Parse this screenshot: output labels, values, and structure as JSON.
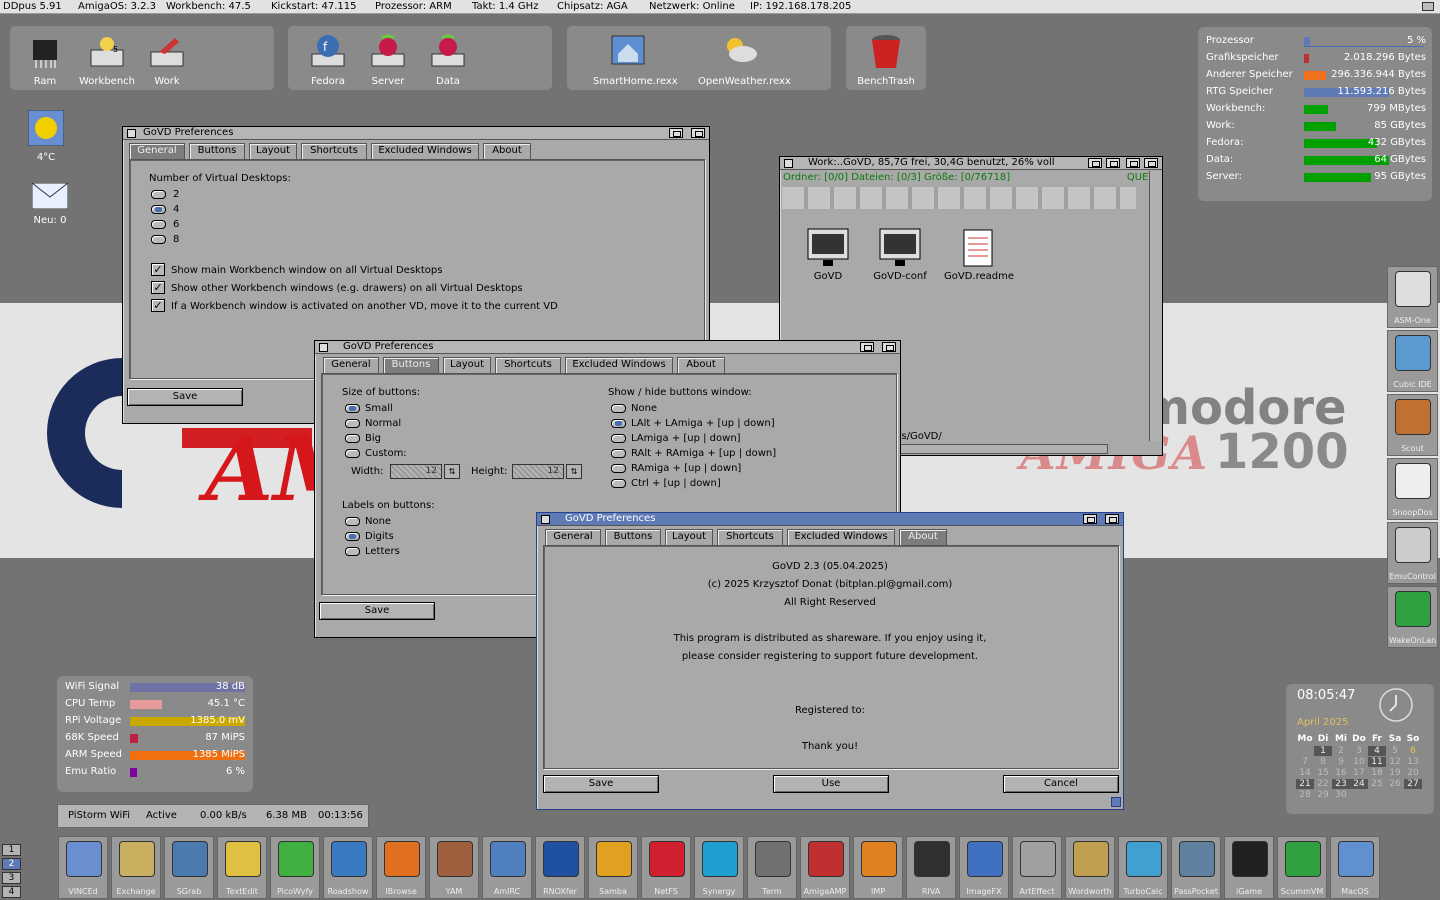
{
  "menubar": {
    "items": [
      "DDpus 5.91",
      "AmigaOS: 3.2.3",
      "Workbench: 47.5",
      "Kickstart: 47.115",
      "Prozessor: ARM",
      "Takt: 1.4 GHz",
      "Chipsatz: AGA",
      "Netzwerk: Online",
      "IP: 192.168.178.205"
    ]
  },
  "top_icons": {
    "panel1": [
      "Ram",
      "Workbench",
      "Work"
    ],
    "panel2": [
      "Fedora",
      "Server",
      "Data"
    ],
    "panel3": [
      "SmartHome.rexx",
      "OpenWeather.rexx"
    ],
    "panel4": [
      "BenchTrash"
    ]
  },
  "desktop_icons": {
    "weather": "4°C",
    "mail": "Neu: 0"
  },
  "backdrop": {
    "modore": "modore",
    "amiga_red": "AMIGA",
    "amiga_num": "1200",
    "am": "AM"
  },
  "win_general": {
    "title": "GoVD Preferences",
    "tabs": [
      "General",
      "Buttons",
      "Layout",
      "Shortcuts",
      "Excluded Windows",
      "About"
    ],
    "num_label": "Number of Virtual Desktops:",
    "num_options": [
      "2",
      "4",
      "6",
      "8"
    ],
    "checks": [
      "Show main Workbench window on all Virtual Desktops",
      "Show other Workbench windows (e.g. drawers) on all Virtual Desktops",
      "If a Workbench window is activated on another VD, move it to the current VD"
    ],
    "save": "Save"
  },
  "win_buttons": {
    "title": "GoVD Preferences",
    "tabs": [
      "General",
      "Buttons",
      "Layout",
      "Shortcuts",
      "Excluded Windows",
      "About"
    ],
    "size_label": "Size of buttons:",
    "size_options": [
      "Small",
      "Normal",
      "Big",
      "Custom:"
    ],
    "width_label": "Width:",
    "width_value": "12",
    "height_label": "Height:",
    "height_value": "12",
    "labels_label": "Labels on buttons:",
    "labels_options": [
      "None",
      "Digits",
      "Letters"
    ],
    "show_label": "Show / hide buttons window:",
    "show_options": [
      "None",
      "LAlt + LAmiga + [up | down]",
      "LAmiga + [up | down]",
      "RAlt + RAmiga + [up | down]",
      "RAmiga + [up | down]",
      "Ctrl + [up | down]"
    ],
    "save": "Save"
  },
  "win_about": {
    "title": "GoVD Preferences",
    "tabs": [
      "General",
      "Buttons",
      "Layout",
      "Shortcuts",
      "Excluded Windows",
      "About"
    ],
    "lines": [
      "GoVD 2.3  (05.04.2025)",
      "(c) 2025 Krzysztof Donat (bitplan.pl@gmail.com)",
      "All Right Reserved",
      "This program is distributed as shareware. If you enjoy using it,",
      "please consider registering to support future development.",
      "Registered to:",
      "Thank you!"
    ],
    "save": "Save",
    "use": "Use",
    "cancel": "Cancel"
  },
  "win_work": {
    "title": "Work:..GoVD,  85,7G frei, 30,4G benutzt, 26% voll",
    "status": "Ordner: [0/0] Dateien: [0/3] Größe: [0/76718]",
    "quel": "QUEL",
    "path": "/s/GoVD/",
    "files": [
      "GoVD",
      "GoVD-conf",
      "GoVD.readme"
    ]
  },
  "stats": {
    "rows": [
      {
        "label": "Prozessor",
        "value": "5 %",
        "color": "#5f7bb6",
        "fill": 0.05
      },
      {
        "label": "Grafikspeicher",
        "value": "2.018.296 Bytes",
        "color": "#c03030",
        "fill": 0.04
      },
      {
        "label": "Anderer Speicher",
        "value": "296.336.944 Bytes",
        "color": "#f07020",
        "fill": 0.18
      },
      {
        "label": "RTG Speicher",
        "value": "11.593.216 Bytes",
        "color": "#5f7bb6",
        "fill": 0.7
      },
      {
        "label": "Workbench:",
        "value": "799 MBytes",
        "color": "#00a000",
        "fill": 0.2
      },
      {
        "label": "Work:",
        "value": "85 GBytes",
        "color": "#00a000",
        "fill": 0.26
      },
      {
        "label": "Fedora:",
        "value": "432 GBytes",
        "color": "#00a000",
        "fill": 0.6
      },
      {
        "label": "Data:",
        "value": "64 GBytes",
        "color": "#00a000",
        "fill": 0.7
      },
      {
        "label": "Server:",
        "value": "95 GBytes",
        "color": "#00a000",
        "fill": 0.55
      }
    ]
  },
  "sys": {
    "rows": [
      {
        "label": "WiFi Signal",
        "value": "38 dB",
        "color": "#6e72a4",
        "fill": 1.0
      },
      {
        "label": "CPU Temp",
        "value": "45.1  °C",
        "color": "#e79a9a",
        "fill": 0.28
      },
      {
        "label": "RPi Voltage",
        "value": "1385.0  mV",
        "color": "#c9a800",
        "fill": 1.0
      },
      {
        "label": "68K Speed",
        "value": "87 MiPS",
        "color": "#c02040",
        "fill": 0.07
      },
      {
        "label": "ARM Speed",
        "value": "1385 MiPS",
        "color": "#f07010",
        "fill": 1.0
      },
      {
        "label": "Emu Ratio",
        "value": "6 %",
        "color": "#8000a0",
        "fill": 0.06
      }
    ]
  },
  "pistorm": {
    "name": "PiStorm WiFi",
    "status": "Active",
    "rate": "0.00 kB/s",
    "mem": "6.38 MB",
    "time": "00:13:56"
  },
  "clock": {
    "time": "08:05:47",
    "month": "April  2025",
    "days": [
      "Mo",
      "Di",
      "Mi",
      "Do",
      "Fr",
      "Sa",
      "So"
    ],
    "dates": [
      "",
      "1",
      "2",
      "3",
      "4",
      "5",
      "6",
      "7",
      "8",
      "9",
      "10",
      "11",
      "12",
      "13",
      "14",
      "15",
      "16",
      "17",
      "18",
      "19",
      "20",
      "21",
      "22",
      "23",
      "24",
      "25",
      "26",
      "27",
      "28",
      "29",
      "30"
    ]
  },
  "vd_numbers": [
    "1",
    "2",
    "3",
    "4"
  ],
  "dock": [
    "VINCEd",
    "Exchange",
    "SGrab",
    "TextEdit",
    "PicoWyfy",
    "Roadshow",
    "IBrowse",
    "YAM",
    "AmIRC",
    "RNOXfer",
    "Samba",
    "NetFS",
    "Synergy",
    "Term",
    "AmigaAMP",
    "IMP",
    "RIVA",
    "ImageFX",
    "ArtEffect",
    "Wordworth",
    "TurboCalc",
    "PassPocket",
    "iGame",
    "ScummVM",
    "MacOS"
  ],
  "sidedock": [
    "ASM-One",
    "Cubic IDE",
    "Scout",
    "SnoopDos",
    "EmuControl",
    "WakeOnLan"
  ],
  "colors": {
    "active_title": "#5f7bb6",
    "desktop": "#737373",
    "window": "#a9a9a9"
  }
}
